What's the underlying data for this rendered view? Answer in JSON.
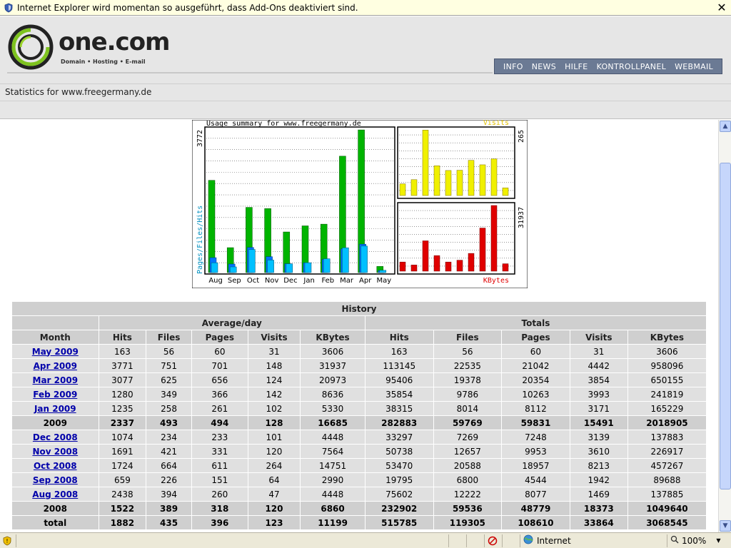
{
  "infobar": {
    "message": "Internet Explorer wird momentan so ausgeführt, dass Add-Ons deaktiviert sind.",
    "close": "✕"
  },
  "logo": {
    "brand": "one.com",
    "tagline": "Domain • Hosting • E-mail"
  },
  "nav": [
    {
      "label": "INFO"
    },
    {
      "label": "NEWS"
    },
    {
      "label": "HILFE"
    },
    {
      "label": "KONTROLLPANEL"
    },
    {
      "label": "WEBMAIL"
    }
  ],
  "stats_title": "Statistics for www.freegermany.de",
  "chart_data": [
    {
      "type": "bar",
      "title": "Usage summary for www.freegermany.de",
      "categories": [
        "Aug",
        "Sep",
        "Oct",
        "Nov",
        "Dec",
        "Jan",
        "Feb",
        "Mar",
        "Apr",
        "May"
      ],
      "ylabel": "Pages/Files/Hits",
      "ymax_label": "3772",
      "ylim": [
        0,
        3772
      ],
      "series": [
        {
          "name": "Hits",
          "color": "#00b400",
          "values": [
            2438,
            659,
            1724,
            1691,
            1074,
            1235,
            1280,
            3077,
            3771,
            163
          ]
        },
        {
          "name": "Files",
          "color": "#0074ff",
          "values": [
            394,
            226,
            664,
            421,
            234,
            258,
            349,
            625,
            751,
            56
          ]
        },
        {
          "name": "Pages",
          "color": "#00c0ff",
          "values": [
            260,
            151,
            611,
            331,
            233,
            261,
            366,
            656,
            701,
            60
          ]
        }
      ]
    },
    {
      "type": "bar",
      "title": "Visits",
      "ymax_label": "265",
      "ylim": [
        0,
        265
      ],
      "series": [
        {
          "name": "Visits",
          "color": "#f0f000",
          "values": [
            47,
            64,
            264,
            120,
            101,
            102,
            142,
            124,
            148,
            31
          ]
        }
      ]
    },
    {
      "type": "bar",
      "title": "KBytes",
      "ymax_label": "31937",
      "ylim": [
        0,
        31937
      ],
      "series": [
        {
          "name": "KBytes",
          "color": "#e00000",
          "values": [
            4448,
            2990,
            14751,
            7564,
            4448,
            5330,
            8636,
            20973,
            31937,
            3606
          ]
        }
      ]
    }
  ],
  "history": {
    "title": "History",
    "group_avg": "Average/day",
    "group_tot": "Totals",
    "columns": [
      "Month",
      "Hits",
      "Files",
      "Pages",
      "Visits",
      "KBytes",
      "Hits",
      "Files",
      "Pages",
      "Visits",
      "KBytes"
    ],
    "rows": [
      {
        "month": "May 2009",
        "link": true,
        "cells": [
          "163",
          "56",
          "60",
          "31",
          "3606",
          "163",
          "56",
          "60",
          "31",
          "3606"
        ]
      },
      {
        "month": "Apr 2009",
        "link": true,
        "cells": [
          "3771",
          "751",
          "701",
          "148",
          "31937",
          "113145",
          "22535",
          "21042",
          "4442",
          "958096"
        ]
      },
      {
        "month": "Mar 2009",
        "link": true,
        "cells": [
          "3077",
          "625",
          "656",
          "124",
          "20973",
          "95406",
          "19378",
          "20354",
          "3854",
          "650155"
        ]
      },
      {
        "month": "Feb 2009",
        "link": true,
        "cells": [
          "1280",
          "349",
          "366",
          "142",
          "8636",
          "35854",
          "9786",
          "10263",
          "3993",
          "241819"
        ]
      },
      {
        "month": "Jan 2009",
        "link": true,
        "cells": [
          "1235",
          "258",
          "261",
          "102",
          "5330",
          "38315",
          "8014",
          "8112",
          "3171",
          "165229"
        ]
      },
      {
        "month": "2009",
        "link": false,
        "cells": [
          "2337",
          "493",
          "494",
          "128",
          "16685",
          "282883",
          "59769",
          "59831",
          "15491",
          "2018905"
        ]
      },
      {
        "month": "Dec 2008",
        "link": true,
        "cells": [
          "1074",
          "234",
          "233",
          "101",
          "4448",
          "33297",
          "7269",
          "7248",
          "3139",
          "137883"
        ]
      },
      {
        "month": "Nov 2008",
        "link": true,
        "cells": [
          "1691",
          "421",
          "331",
          "120",
          "7564",
          "50738",
          "12657",
          "9953",
          "3610",
          "226917"
        ]
      },
      {
        "month": "Oct 2008",
        "link": true,
        "cells": [
          "1724",
          "664",
          "611",
          "264",
          "14751",
          "53470",
          "20588",
          "18957",
          "8213",
          "457267"
        ]
      },
      {
        "month": "Sep 2008",
        "link": true,
        "cells": [
          "659",
          "226",
          "151",
          "64",
          "2990",
          "19795",
          "6800",
          "4544",
          "1942",
          "89688"
        ]
      },
      {
        "month": "Aug 2008",
        "link": true,
        "cells": [
          "2438",
          "394",
          "260",
          "47",
          "4448",
          "75602",
          "12222",
          "8077",
          "1469",
          "137885"
        ]
      },
      {
        "month": "2008",
        "link": false,
        "cells": [
          "1522",
          "389",
          "318",
          "120",
          "6860",
          "232902",
          "59536",
          "48779",
          "18373",
          "1049640"
        ]
      },
      {
        "month": "total",
        "link": false,
        "cells": [
          "1882",
          "435",
          "396",
          "123",
          "11199",
          "515785",
          "119305",
          "108610",
          "33864",
          "3068545"
        ]
      }
    ]
  },
  "statusbar": {
    "zone": "Internet",
    "zoom": "100%"
  }
}
